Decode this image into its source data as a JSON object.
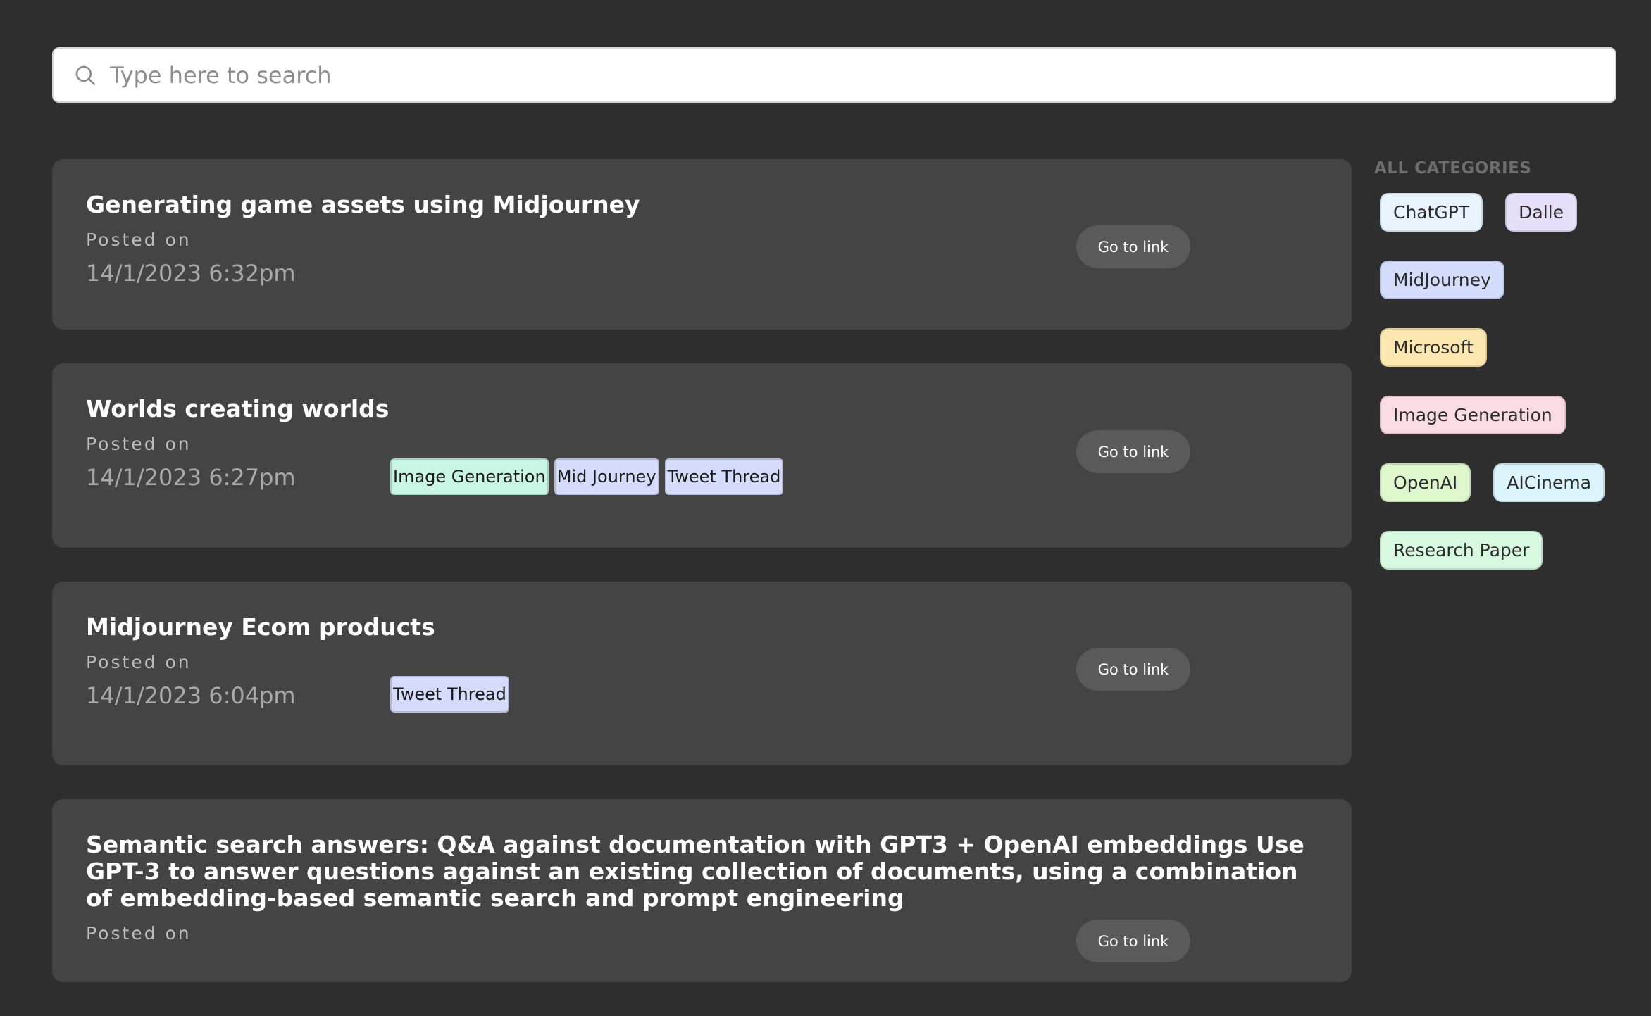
{
  "search": {
    "placeholder": "Type here to search",
    "value": ""
  },
  "posts": [
    {
      "title": "Generating game assets using Midjourney",
      "posted_label": "Posted on",
      "date": "14/1/2023 6:32pm",
      "tags": [],
      "button_label": "Go to link"
    },
    {
      "title": "Worlds creating worlds",
      "posted_label": "Posted on",
      "date": "14/1/2023 6:27pm",
      "tags": [
        {
          "label": "Image Generation",
          "color": "#c9f5e3"
        },
        {
          "label": "Mid Journey",
          "color": "#d5dcfb"
        },
        {
          "label": "Tweet Thread",
          "color": "#d5dcfb"
        }
      ],
      "button_label": "Go to link"
    },
    {
      "title": "Midjourney Ecom products",
      "posted_label": "Posted on",
      "date": "14/1/2023 6:04pm",
      "tags": [
        {
          "label": "Tweet Thread",
          "color": "#d5dcfb"
        }
      ],
      "button_label": "Go to link"
    },
    {
      "title": "Semantic search answers: Q&A against documentation with GPT3 + OpenAI embeddings Use GPT-3 to answer questions against an existing collection of documents, using a combination of embedding-based semantic search and prompt engineering",
      "posted_label": "Posted on",
      "date": "",
      "tags": [],
      "button_label": "Go to link"
    }
  ],
  "categories": {
    "heading": "ALL CATEGORIES",
    "items": [
      {
        "label": "ChatGPT",
        "color": "#e9f3fd"
      },
      {
        "label": "Dalle",
        "color": "#e7defa"
      },
      {
        "label": "MidJourney",
        "color": "#d3dcfb"
      },
      {
        "label": "Microsoft",
        "color": "#fce7b0"
      },
      {
        "label": "Image Generation",
        "color": "#fbdbe2"
      },
      {
        "label": "OpenAI",
        "color": "#ddf6cc"
      },
      {
        "label": "AICinema",
        "color": "#dcf5fc"
      },
      {
        "label": "Research Paper",
        "color": "#d7f9e0"
      }
    ]
  }
}
